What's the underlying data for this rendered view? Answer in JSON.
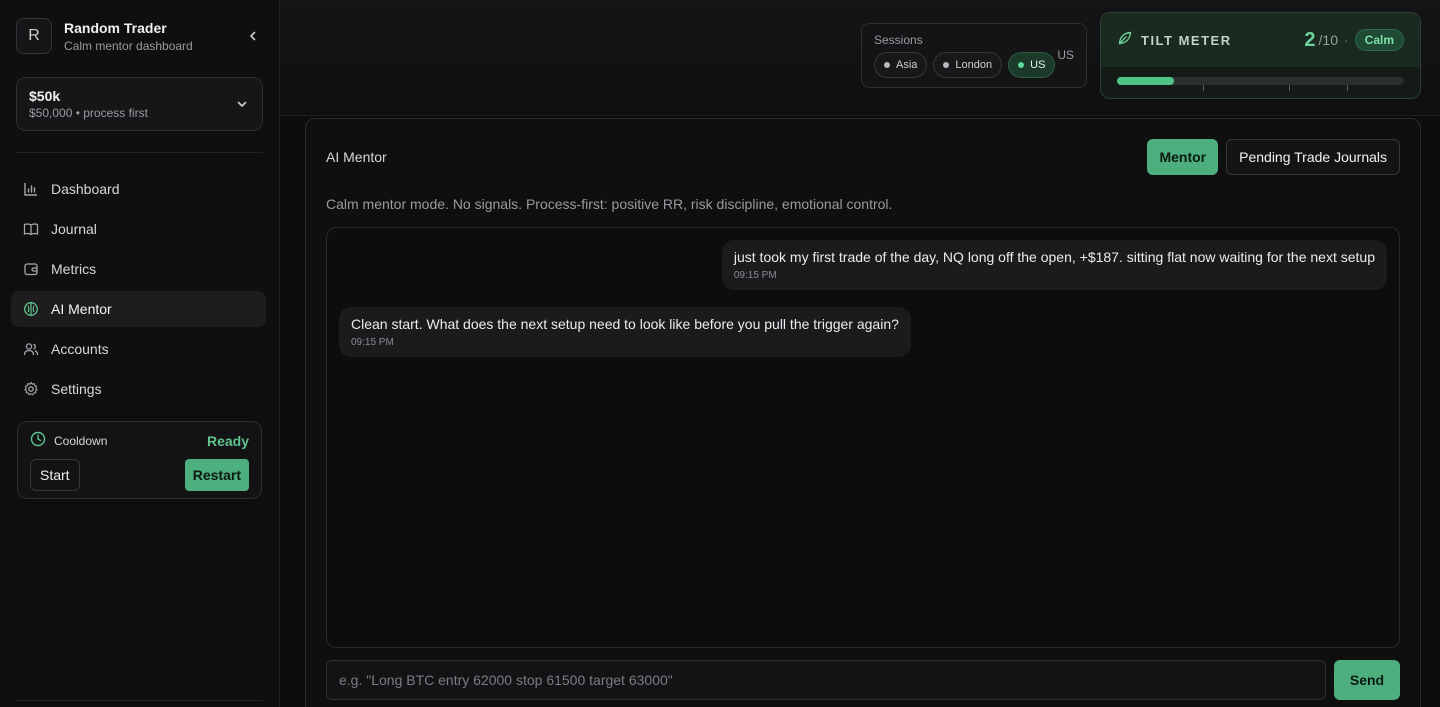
{
  "profile": {
    "initial": "R",
    "name": "Random Trader",
    "subtitle": "Calm mentor dashboard"
  },
  "account": {
    "title": "$50k",
    "subtitle": "$50,000 • process first"
  },
  "sidebar": {
    "items": [
      {
        "label": "Dashboard",
        "icon": "bar-chart-icon",
        "active": false
      },
      {
        "label": "Journal",
        "icon": "book-icon",
        "active": false
      },
      {
        "label": "Metrics",
        "icon": "wallet-icon",
        "active": false
      },
      {
        "label": "AI Mentor",
        "icon": "brain-icon",
        "active": true
      },
      {
        "label": "Accounts",
        "icon": "users-icon",
        "active": false
      },
      {
        "label": "Settings",
        "icon": "gear-icon",
        "active": false
      }
    ]
  },
  "cooldown": {
    "label": "Cooldown",
    "status": "Ready",
    "start_label": "Start",
    "restart_label": "Restart"
  },
  "sessions": {
    "label": "Sessions",
    "options": [
      "Asia",
      "London",
      "US"
    ],
    "active": "US",
    "current": "US"
  },
  "tilt": {
    "title": "TILT METER",
    "score": "2",
    "max": "/10",
    "separator": "·",
    "state": "Calm",
    "level": 0.2
  },
  "panel": {
    "title": "AI Mentor",
    "tabs": {
      "mentor": "Mentor",
      "journals": "Pending Trade Journals"
    },
    "description": "Calm mentor mode. No signals. Process-first: positive RR, risk discipline, emotional control."
  },
  "messages": [
    {
      "role": "user",
      "text": "just took my first trade of the day, NQ long off the open, +$187. sitting flat now waiting for the next setup",
      "time": "09:15 PM"
    },
    {
      "role": "mentor",
      "text": "Clean start. What does the next setup need to look like before you pull the trigger again?",
      "time": "09:15 PM"
    }
  ],
  "composer": {
    "placeholder": "e.g. \"Long BTC entry 62000 stop 61500 target 63000\"",
    "send_label": "Send"
  },
  "colors": {
    "accent": "#4caf7d",
    "accent_text": "#5fc48d"
  }
}
